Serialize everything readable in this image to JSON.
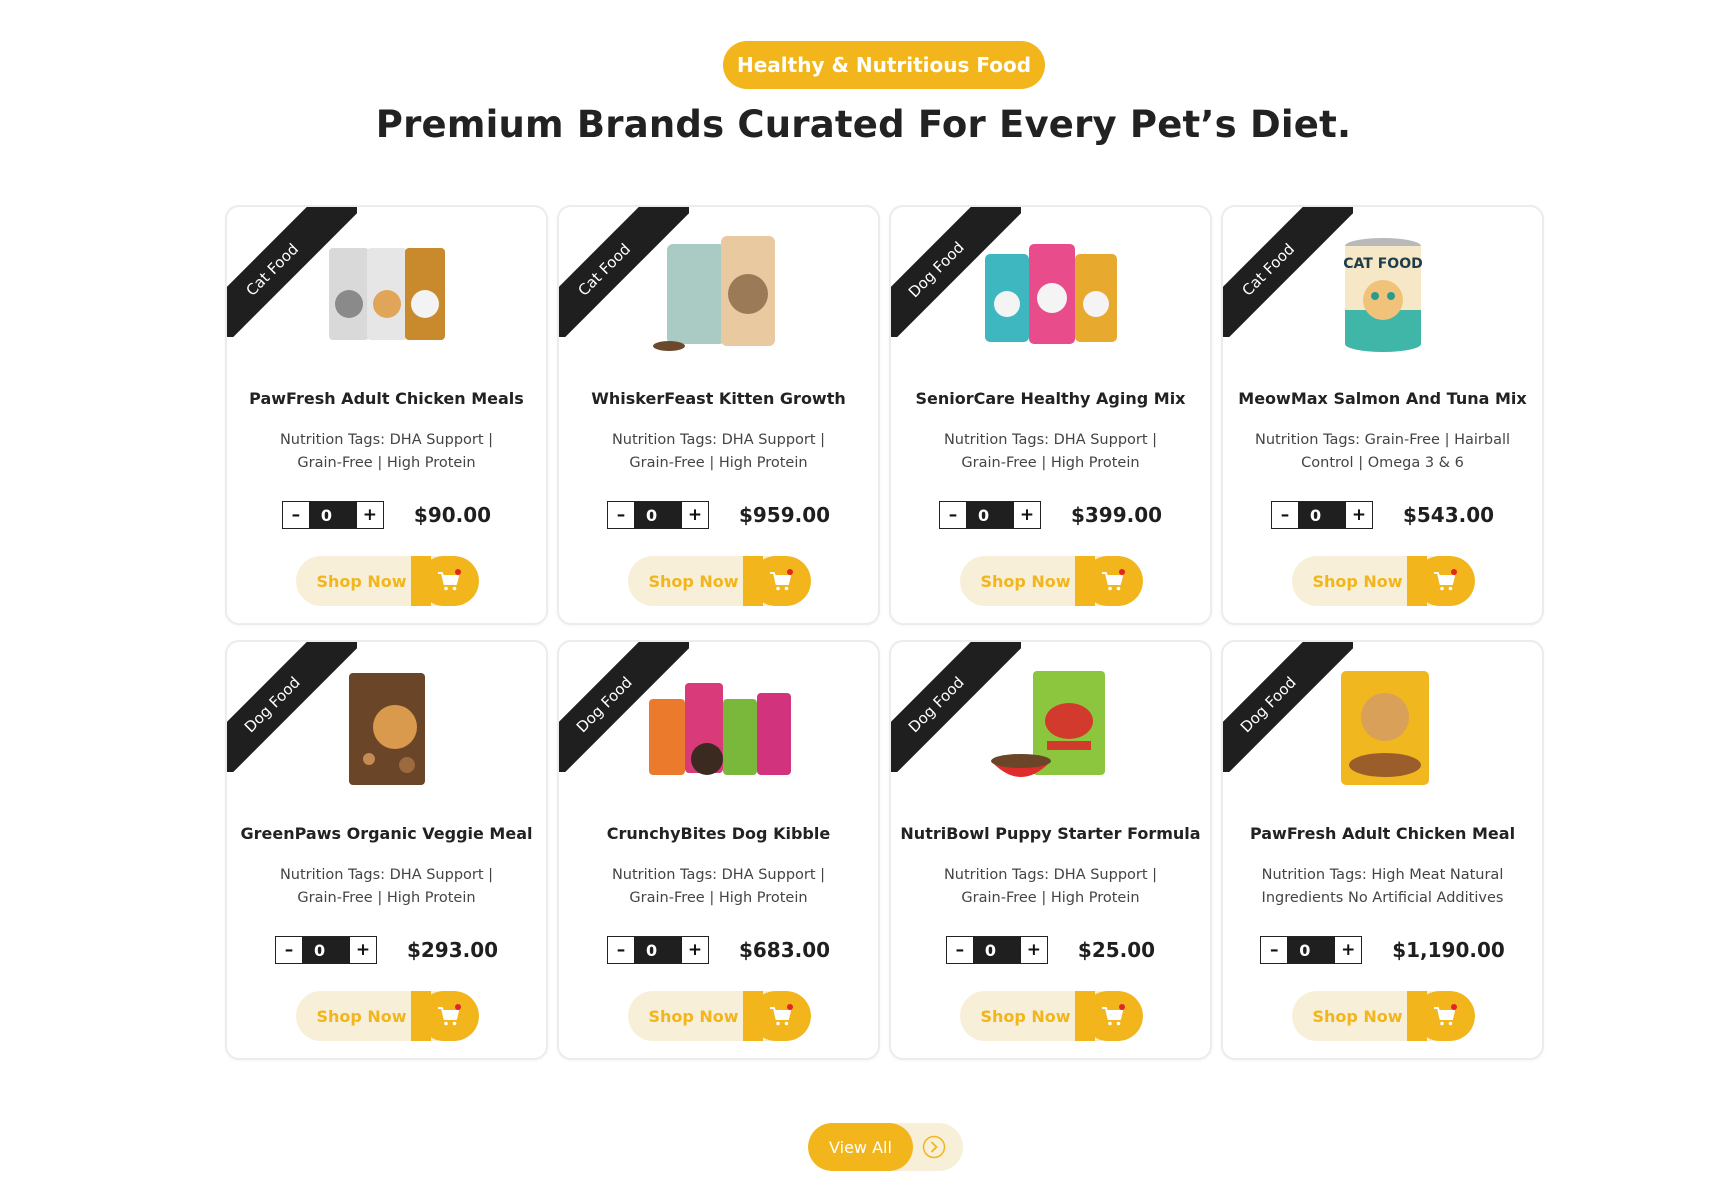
{
  "header": {
    "badge": "Healthy & Nutritious Food",
    "title": "Premium Brands Curated For Every Pet’s Diet."
  },
  "colors": {
    "accent": "#f2b51c",
    "accent_light": "#f8efd9",
    "ribbon": "#1f1f1f"
  },
  "products": [
    {
      "category": "Cat Food",
      "name": "PawFresh Adult Chicken Meals",
      "tags": "Nutrition Tags: DHA Support | Grain-Free | High Protein",
      "qty": "0",
      "price": "$90.00",
      "shop_label": "Shop Now",
      "image": "cat-food-pouches"
    },
    {
      "category": "Cat Food",
      "name": "WhiskerFeast Kitten Growth",
      "tags": "Nutrition Tags: DHA Support | Grain-Free | High Protein",
      "qty": "0",
      "price": "$959.00",
      "shop_label": "Shop Now",
      "image": "cat-food-bags"
    },
    {
      "category": "Dog Food",
      "name": "SeniorCare Healthy Aging Mix",
      "tags": "Nutrition Tags: DHA Support | Grain-Free | High Protein",
      "qty": "0",
      "price": "$399.00",
      "shop_label": "Shop Now",
      "image": "dog-food-pouches"
    },
    {
      "category": "Cat Food",
      "name": "MeowMax Salmon And Tuna Mix",
      "tags": "Nutrition Tags: Grain-Free | Hairball Control | Omega 3 & 6",
      "qty": "0",
      "price": "$543.00",
      "shop_label": "Shop Now",
      "image": "cat-food-can",
      "can_label": "CAT FOOD"
    },
    {
      "category": "Dog Food",
      "name": "GreenPaws Organic Veggie Meal",
      "tags": "Nutrition Tags: DHA Support | Grain-Free | High Protein",
      "qty": "0",
      "price": "$293.00",
      "shop_label": "Shop Now",
      "image": "dog-food-brown-bag"
    },
    {
      "category": "Dog Food",
      "name": "CrunchyBites Dog Kibble",
      "tags": "Nutrition Tags: DHA Support | Grain-Free | High Protein",
      "qty": "0",
      "price": "$683.00",
      "shop_label": "Shop Now",
      "image": "dog-food-pouch-set"
    },
    {
      "category": "Dog Food",
      "name": "NutriBowl Puppy Starter Formula",
      "tags": "Nutrition Tags: DHA Support | Grain-Free | High Protein",
      "qty": "0",
      "price": "$25.00",
      "shop_label": "Shop Now",
      "image": "dog-food-green-bag-bowl"
    },
    {
      "category": "Dog Food",
      "name": "PawFresh Adult Chicken Meal",
      "tags": "Nutrition Tags: High Meat Natural Ingredients No Artificial Additives",
      "qty": "0",
      "price": "$1,190.00",
      "shop_label": "Shop Now",
      "image": "dog-food-yellow-bag"
    }
  ],
  "stepper": {
    "minus": "–",
    "plus": "+"
  },
  "footer": {
    "view_all": "View All"
  }
}
